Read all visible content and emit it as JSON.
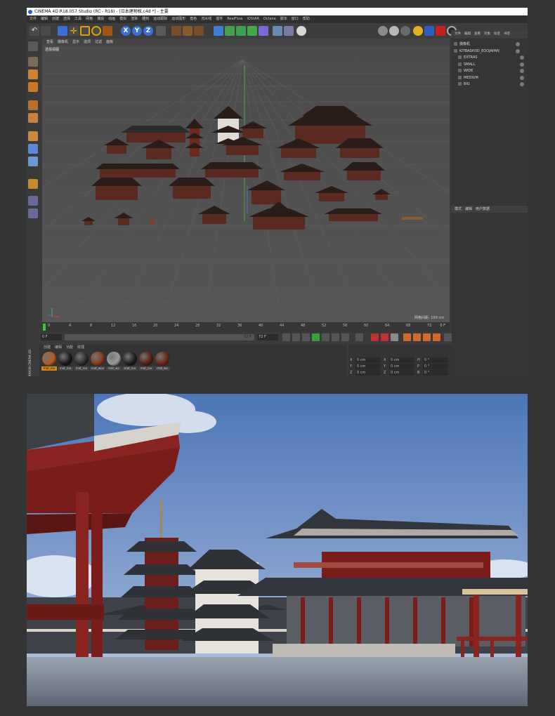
{
  "window": {
    "title": "CINEMA 4D R18.057 Studio (RC - R18) - [日本建物枚.c4d *] - 主要",
    "menus": [
      "文件",
      "编辑",
      "创建",
      "选择",
      "工具",
      "网格",
      "捕捉",
      "动画",
      "模拟",
      "渲染",
      "雕刻",
      "运动跟踪",
      "运动图形",
      "角色",
      "流水线",
      "插件",
      "RealFlow",
      "iOStAR",
      "Octane",
      "脚本",
      "窗口",
      "帮助"
    ]
  },
  "toolbar": {
    "axis_x": "X",
    "axis_y": "Y",
    "axis_z": "Z"
  },
  "viewport": {
    "menus": [
      "查看",
      "摄像机",
      "显示",
      "选项",
      "过滤",
      "面板"
    ],
    "label": "透视视图",
    "grid_readout": "网格间距: 100 cm"
  },
  "object_manager": {
    "menus": [
      "文件",
      "编辑",
      "查看",
      "对象",
      "标签",
      "书签"
    ],
    "items": [
      {
        "name": "摄像机"
      },
      {
        "name": "KITBASH3D_EDOJAPAN"
      },
      {
        "name": "EXTRAS"
      },
      {
        "name": "SMALL"
      },
      {
        "name": "WIDE"
      },
      {
        "name": "MEDIUM"
      },
      {
        "name": "BIG"
      }
    ]
  },
  "attribute_manager": {
    "menus": [
      "模式",
      "编辑",
      "用户数据"
    ]
  },
  "timeline": {
    "ticks": [
      "0",
      "4",
      "8",
      "12",
      "16",
      "20",
      "24",
      "28",
      "32",
      "36",
      "40",
      "44",
      "48",
      "52",
      "56",
      "60",
      "64",
      "68",
      "72"
    ],
    "end_readout": "0 F",
    "current_frame": "0 F",
    "start_field": "0 F",
    "end_field": "72 F",
    "slider_end": "72 F"
  },
  "material_manager": {
    "menus": [
      "创建",
      "编辑",
      "功能",
      "纹理"
    ],
    "materials": [
      {
        "label": "mat_roo",
        "color": "#b65a1e"
      },
      {
        "label": "mat_roo",
        "color": "#1b1b1b"
      },
      {
        "label": "mat_roo",
        "color": "#2a2a2a"
      },
      {
        "label": "mat_woo",
        "color": "#8a3a1a"
      },
      {
        "label": "mat_wa",
        "color": "#9a9a9a"
      },
      {
        "label": "mat_roo",
        "color": "#1e1e1e"
      },
      {
        "label": "mat_roo",
        "color": "#5a1e12"
      },
      {
        "label": "mat_wo",
        "color": "#6b2a16"
      }
    ],
    "side_label": "MAXON CINEMA 4D"
  },
  "coordinates": {
    "rows": [
      {
        "axis": "X",
        "value": "0 cm",
        "axis2": "X",
        "value2": "0 cm",
        "axis3": "H",
        "value3": "0 °"
      },
      {
        "axis": "Y",
        "value": "0 cm",
        "axis2": "Y",
        "value2": "0 cm",
        "axis3": "P",
        "value3": "0 °"
      },
      {
        "axis": "Z",
        "value": "0 cm",
        "axis2": "Z",
        "value2": "0 cm",
        "axis3": "B",
        "value3": "0 °"
      }
    ]
  },
  "colors": {
    "accent": "#2b63c9",
    "playhead": "#3ec43e",
    "render_sky": "#6e90c3",
    "temple_red": "#7a1d1a"
  }
}
